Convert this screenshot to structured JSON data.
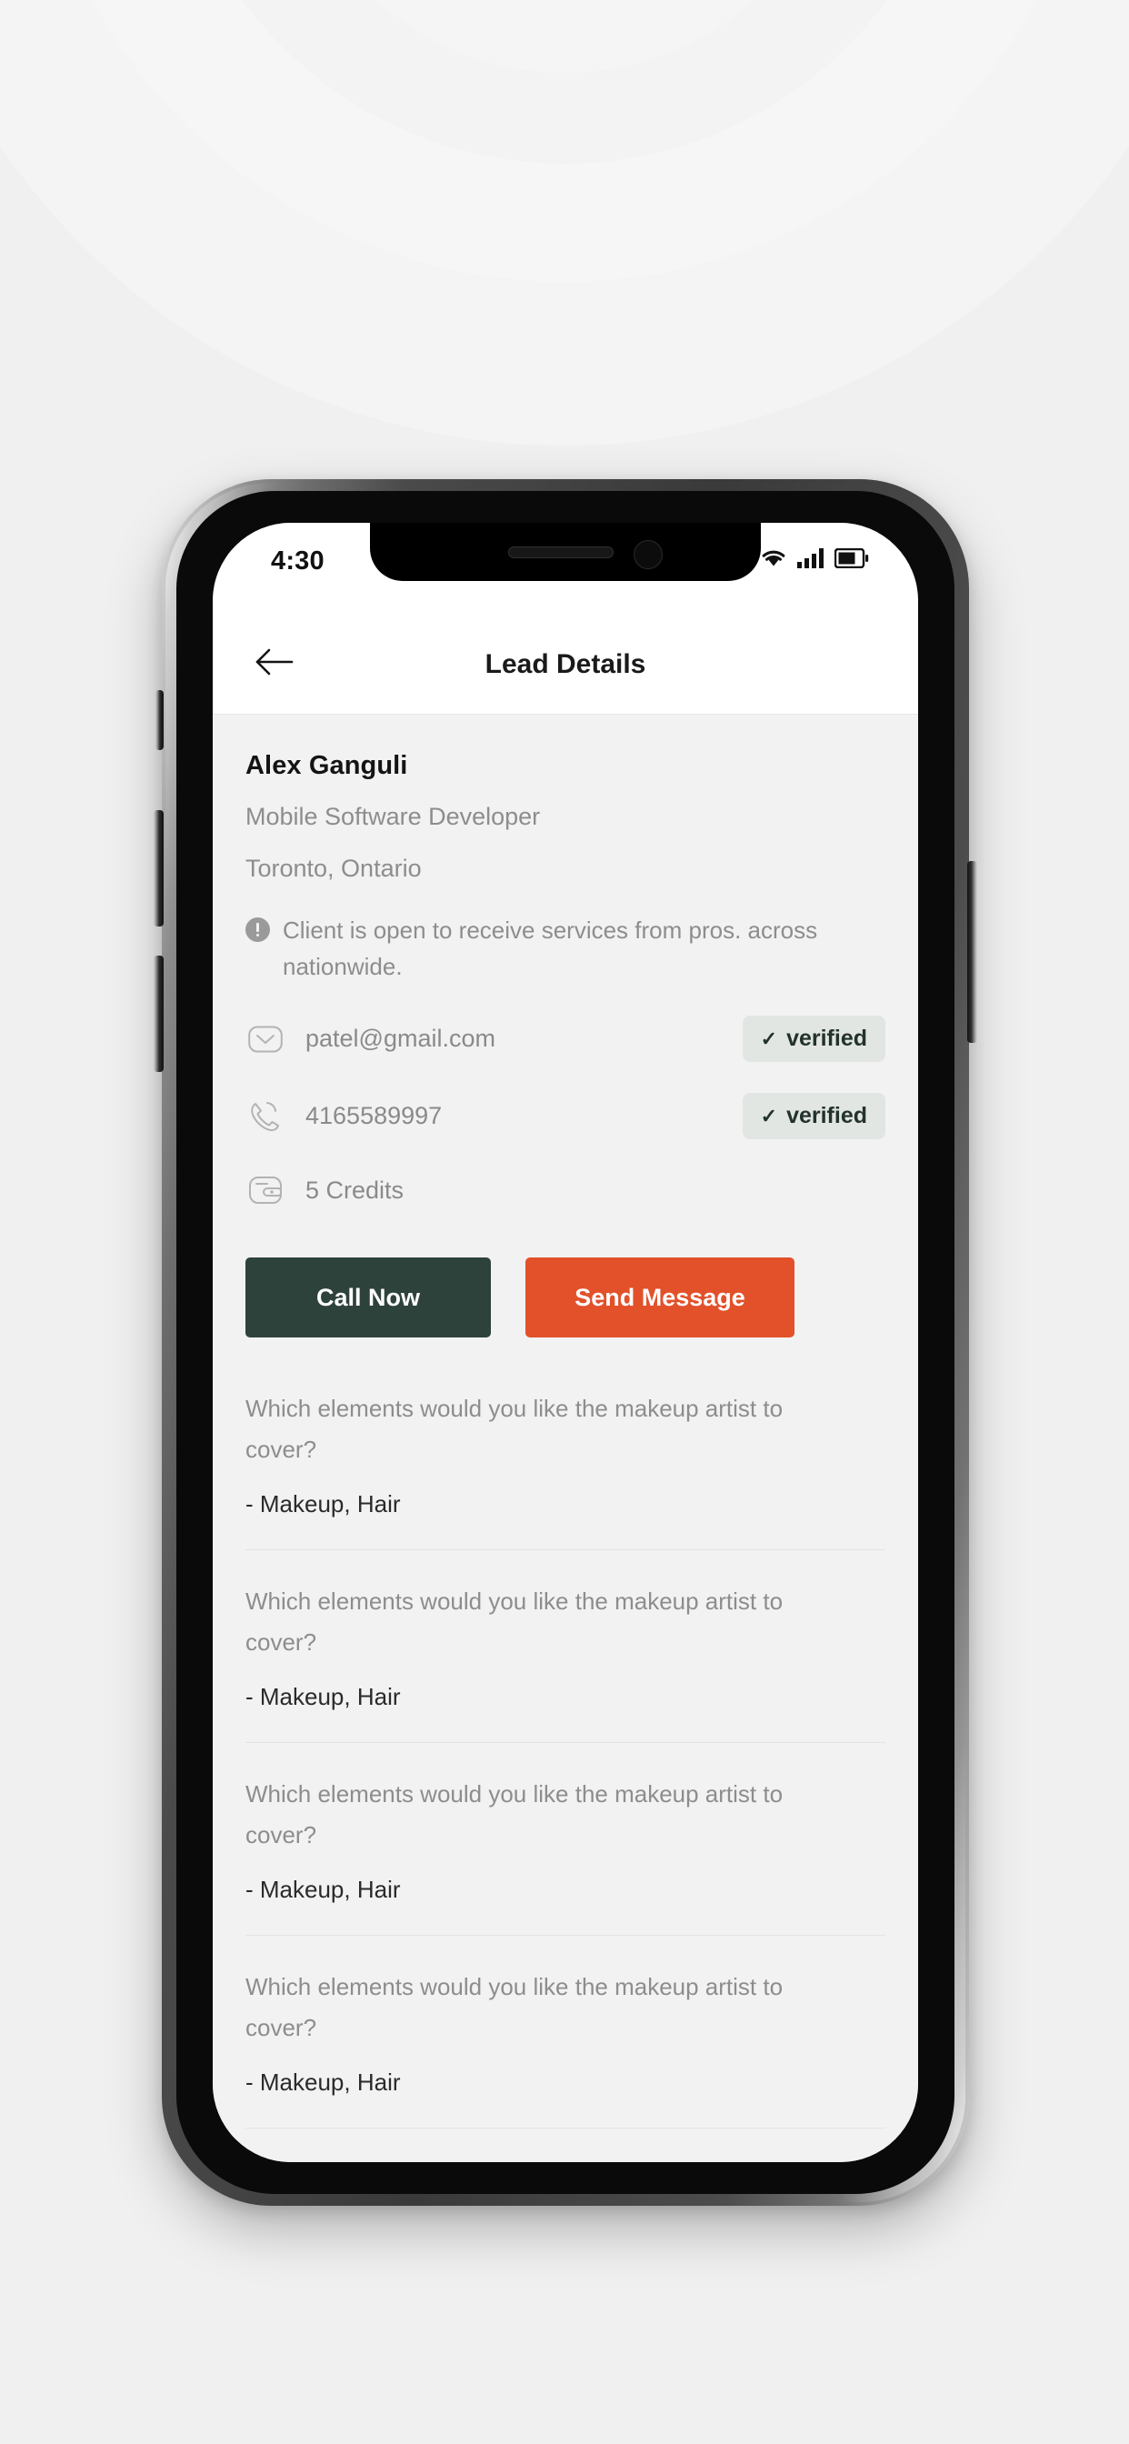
{
  "status_bar": {
    "time": "4:30",
    "wifi_icon": "wifi-icon",
    "signal_icon": "cellular-signal-icon",
    "battery_icon": "battery-icon"
  },
  "nav": {
    "back_icon": "arrow-left-icon",
    "title": "Lead Details"
  },
  "lead": {
    "name": "Alex Ganguli",
    "role": "Mobile Software Developer",
    "location": "Toronto, Ontario",
    "notice_icon": "info-circle-icon",
    "notice": "Client is open to receive services from pros. across nationwide."
  },
  "contact": {
    "email": {
      "icon": "envelope-icon",
      "value": "patel@gmail.com",
      "badge": "verified",
      "badge_check": "✓"
    },
    "phone": {
      "icon": "phone-icon",
      "value": "4165589997",
      "badge": "verified",
      "badge_check": "✓"
    },
    "credits": {
      "icon": "wallet-icon",
      "value": "5 Credits"
    }
  },
  "actions": {
    "call_label": "Call Now",
    "message_label": "Send Message",
    "call_color": "#2e423c",
    "message_color": "#e2512a"
  },
  "qa": [
    {
      "question": "Which elements would you like the makeup artist to cover?",
      "answer": "- Makeup, Hair"
    },
    {
      "question": "Which elements would you like the makeup artist to cover?",
      "answer": "- Makeup, Hair"
    },
    {
      "question": "Which elements would you like the makeup artist to cover?",
      "answer": "- Makeup, Hair"
    },
    {
      "question": "Which elements would you like the makeup artist to cover?",
      "answer": "- Makeup, Hair"
    }
  ],
  "theme": {
    "page_background": "#f0f0f0",
    "screen_background": "#f2f2f2",
    "badge_background": "#e2e6e3",
    "muted_text": "#8d8d8d"
  }
}
